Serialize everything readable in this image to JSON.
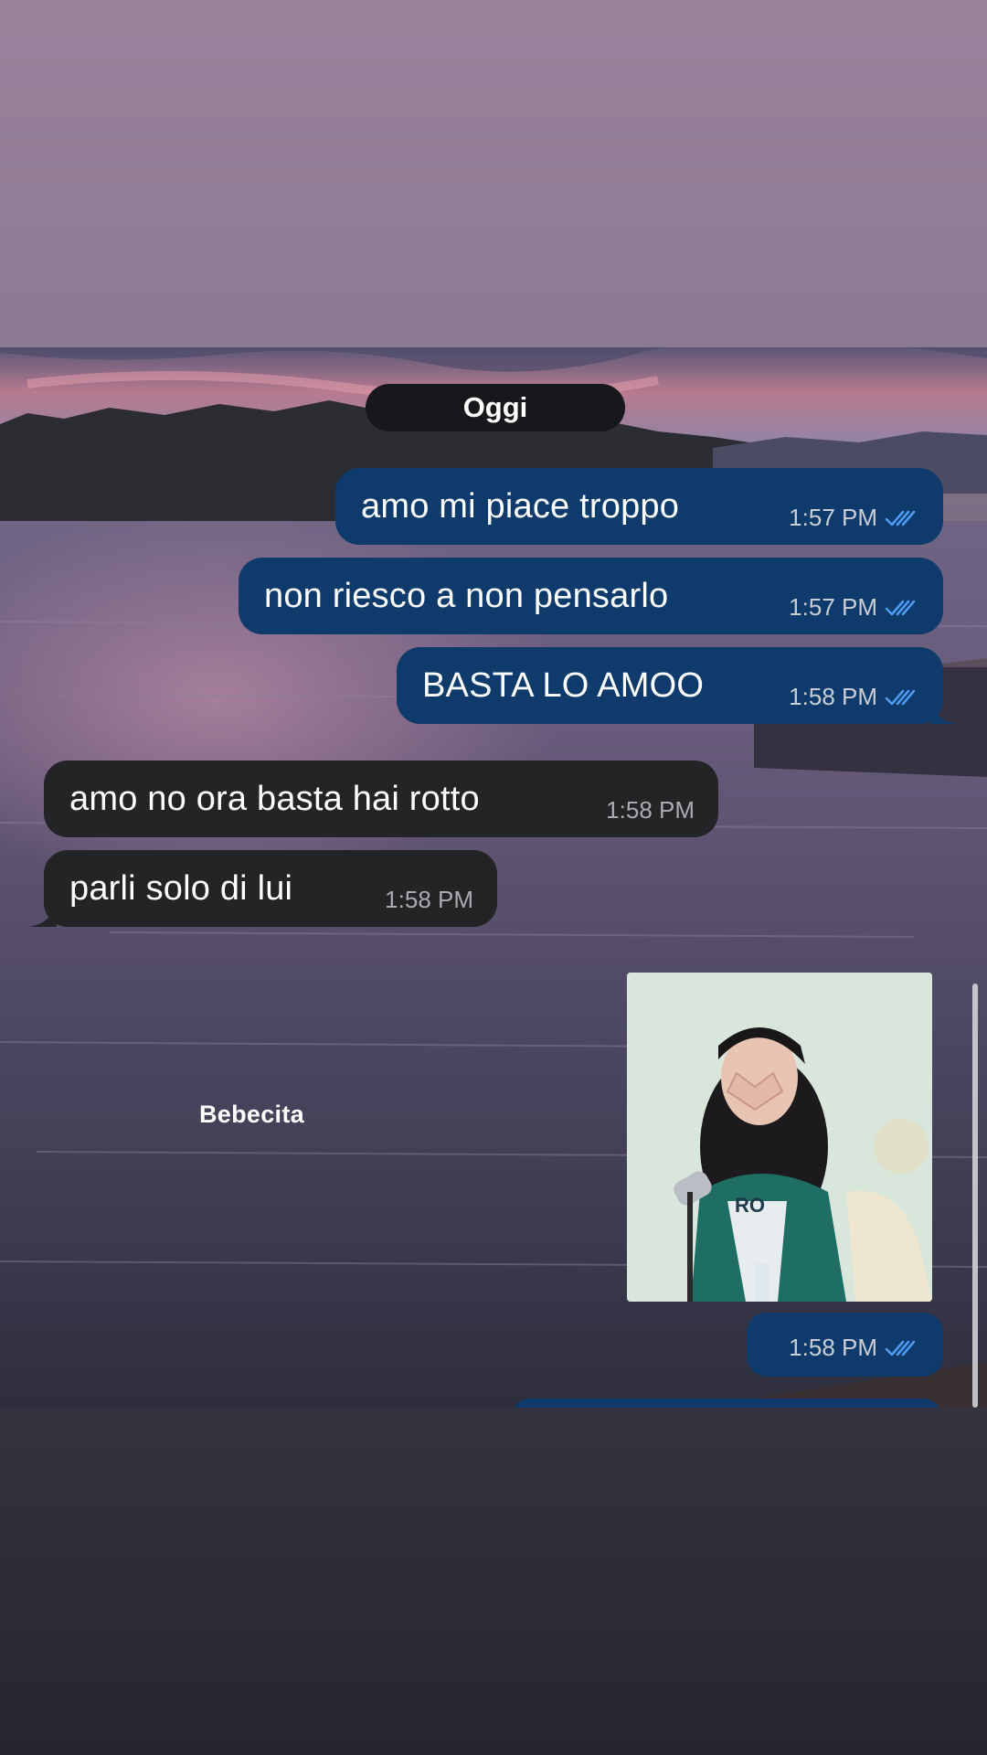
{
  "chat": {
    "date_separator": "Oggi",
    "messages": [
      {
        "direction": "outgoing",
        "text": "amo mi piace troppo",
        "time": "1:57 PM",
        "status": "read"
      },
      {
        "direction": "outgoing",
        "text": "non riesco a non pensarlo",
        "time": "1:57 PM",
        "status": "read"
      },
      {
        "direction": "outgoing",
        "text": "BASTA LO AMOO",
        "time": "1:58 PM",
        "status": "read"
      },
      {
        "direction": "incoming",
        "text": "amo no ora basta hai rotto",
        "time": "1:58 PM"
      },
      {
        "direction": "incoming",
        "text": "parli solo di lui",
        "time": "1:58 PM"
      },
      {
        "direction": "outgoing",
        "type": "photo",
        "time": "1:58 PM",
        "status": "read"
      }
    ]
  },
  "story": {
    "caption": "Bebecita"
  },
  "colors": {
    "outgoing_bubble": "#0e3b6b",
    "incoming_bubble": "#232426",
    "read_ticks": "#4f9cf5"
  },
  "icons": {
    "read_status": "double-check-icon"
  }
}
